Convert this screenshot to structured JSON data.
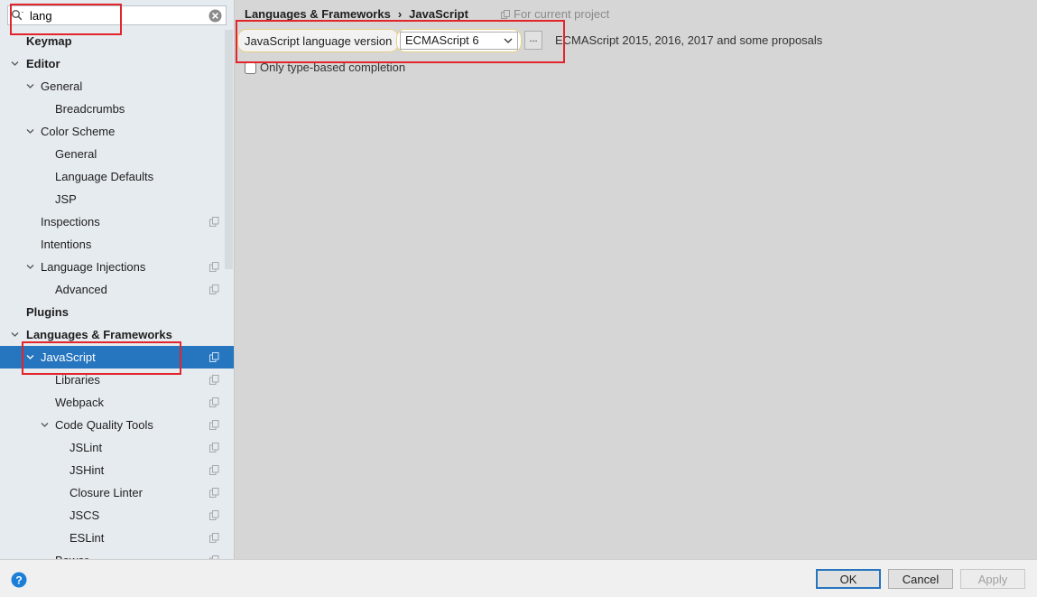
{
  "search": {
    "value": "lang"
  },
  "tree": [
    {
      "label": "Keymap",
      "level": 0,
      "bold": true,
      "arrow": false,
      "copy": false
    },
    {
      "label": "Editor",
      "level": 0,
      "bold": true,
      "arrow": true,
      "copy": false
    },
    {
      "label": "General",
      "level": 1,
      "bold": false,
      "arrow": true,
      "copy": false
    },
    {
      "label": "Breadcrumbs",
      "level": 2,
      "bold": false,
      "arrow": false,
      "copy": false
    },
    {
      "label": "Color Scheme",
      "level": 1,
      "bold": false,
      "arrow": true,
      "copy": false
    },
    {
      "label": "General",
      "level": 2,
      "bold": false,
      "arrow": false,
      "copy": false
    },
    {
      "label": "Language Defaults",
      "level": 2,
      "bold": false,
      "arrow": false,
      "copy": false
    },
    {
      "label": "JSP",
      "level": 2,
      "bold": false,
      "arrow": false,
      "copy": false
    },
    {
      "label": "Inspections",
      "level": 1,
      "bold": false,
      "arrow": false,
      "copy": true
    },
    {
      "label": "Intentions",
      "level": 1,
      "bold": false,
      "arrow": false,
      "copy": false
    },
    {
      "label": "Language Injections",
      "level": 1,
      "bold": false,
      "arrow": true,
      "copy": true
    },
    {
      "label": "Advanced",
      "level": 2,
      "bold": false,
      "arrow": false,
      "copy": true
    },
    {
      "label": "Plugins",
      "level": 0,
      "bold": true,
      "arrow": false,
      "copy": false
    },
    {
      "label": "Languages & Frameworks",
      "level": 0,
      "bold": true,
      "arrow": true,
      "copy": false
    },
    {
      "label": "JavaScript",
      "level": 1,
      "bold": false,
      "arrow": true,
      "copy": true,
      "selected": true
    },
    {
      "label": "Libraries",
      "level": 2,
      "bold": false,
      "arrow": false,
      "copy": true
    },
    {
      "label": "Webpack",
      "level": 2,
      "bold": false,
      "arrow": false,
      "copy": true
    },
    {
      "label": "Code Quality Tools",
      "level": 2,
      "bold": false,
      "arrow": true,
      "copy": true
    },
    {
      "label": "JSLint",
      "level": 3,
      "bold": false,
      "arrow": false,
      "copy": true
    },
    {
      "label": "JSHint",
      "level": 3,
      "bold": false,
      "arrow": false,
      "copy": true
    },
    {
      "label": "Closure Linter",
      "level": 3,
      "bold": false,
      "arrow": false,
      "copy": true
    },
    {
      "label": "JSCS",
      "level": 3,
      "bold": false,
      "arrow": false,
      "copy": true
    },
    {
      "label": "ESLint",
      "level": 3,
      "bold": false,
      "arrow": false,
      "copy": true
    },
    {
      "label": "Bower",
      "level": 2,
      "bold": false,
      "arrow": false,
      "copy": true
    }
  ],
  "content": {
    "breadcrumb": [
      "Languages & Frameworks",
      "JavaScript"
    ],
    "breadcrumb_separator": "›",
    "for_project": "For current project",
    "js_version_label": "JavaScript language version",
    "js_version_value": "ECMAScript 6",
    "ellipsis": "...",
    "js_version_description": "ECMAScript 2015, 2016, 2017 and some proposals",
    "type_completion_label": "Only type-based completion",
    "type_completion_checked": false
  },
  "buttons": {
    "ok": "OK",
    "cancel": "Cancel",
    "apply": "Apply"
  },
  "icons": {
    "search": "search-icon",
    "clear": "clear-icon",
    "copy": "copy-icon",
    "help": "help-icon",
    "chevron": "chevron-down-icon"
  },
  "colors": {
    "selection": "#2675bf",
    "annotation_red": "#e3242b",
    "highlight_yellow": "#e8cf85",
    "help_blue": "#1b7fd8"
  }
}
